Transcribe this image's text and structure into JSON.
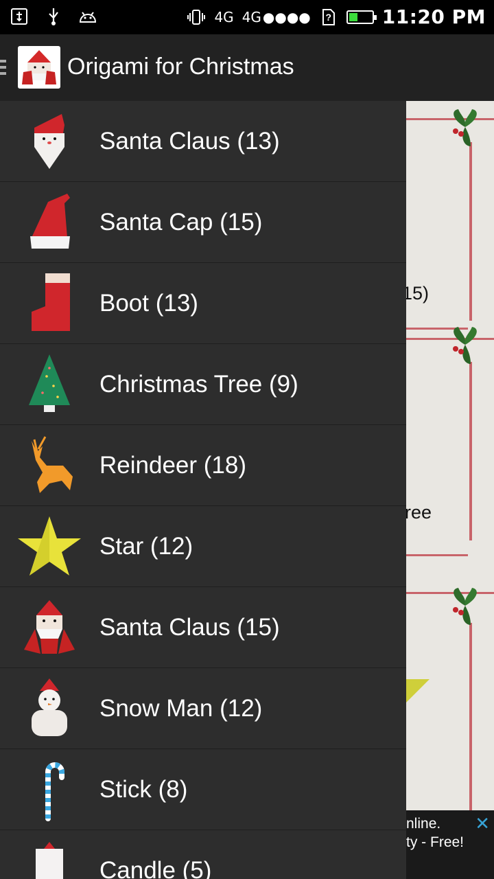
{
  "status_bar": {
    "network_1": "4G",
    "network_2": "4G",
    "signal_dots": "●●●●",
    "sim_badge": "?",
    "time": "11:20 PM",
    "battery_level": 0.45,
    "icons": [
      "usb-debug-icon",
      "usb-icon",
      "android-icon",
      "vibrate-icon",
      "sim-icon",
      "battery-icon"
    ]
  },
  "action_bar": {
    "title": "Origami for Christmas",
    "nav_icon": "hamburger-icon"
  },
  "drawer": {
    "items": [
      {
        "label": "Santa Claus (13)",
        "icon": "santa-claus-icon"
      },
      {
        "label": "Santa Cap (15)",
        "icon": "santa-cap-icon"
      },
      {
        "label": "Boot (13)",
        "icon": "boot-icon"
      },
      {
        "label": "Christmas Tree (9)",
        "icon": "christmas-tree-icon"
      },
      {
        "label": "Reindeer (18)",
        "icon": "reindeer-icon"
      },
      {
        "label": "Star (12)",
        "icon": "star-icon"
      },
      {
        "label": "Santa Claus (15)",
        "icon": "santa-claus-icon"
      },
      {
        "label": "Snow Man (12)",
        "icon": "snowman-icon"
      },
      {
        "label": "Stick (8)",
        "icon": "candy-cane-icon"
      },
      {
        "label": "Candle (5)",
        "icon": "candle-icon"
      }
    ]
  },
  "background": {
    "fragment_1": "15)",
    "fragment_2": "ree"
  },
  "ad": {
    "line_1": "nline.",
    "line_2": "ty - Free!",
    "close": "✕"
  },
  "colors": {
    "drawer_bg": "#2d2d2d",
    "actionbar_bg": "#222222",
    "accent_red": "#c8282d",
    "battery_green": "#3cdc3c"
  }
}
